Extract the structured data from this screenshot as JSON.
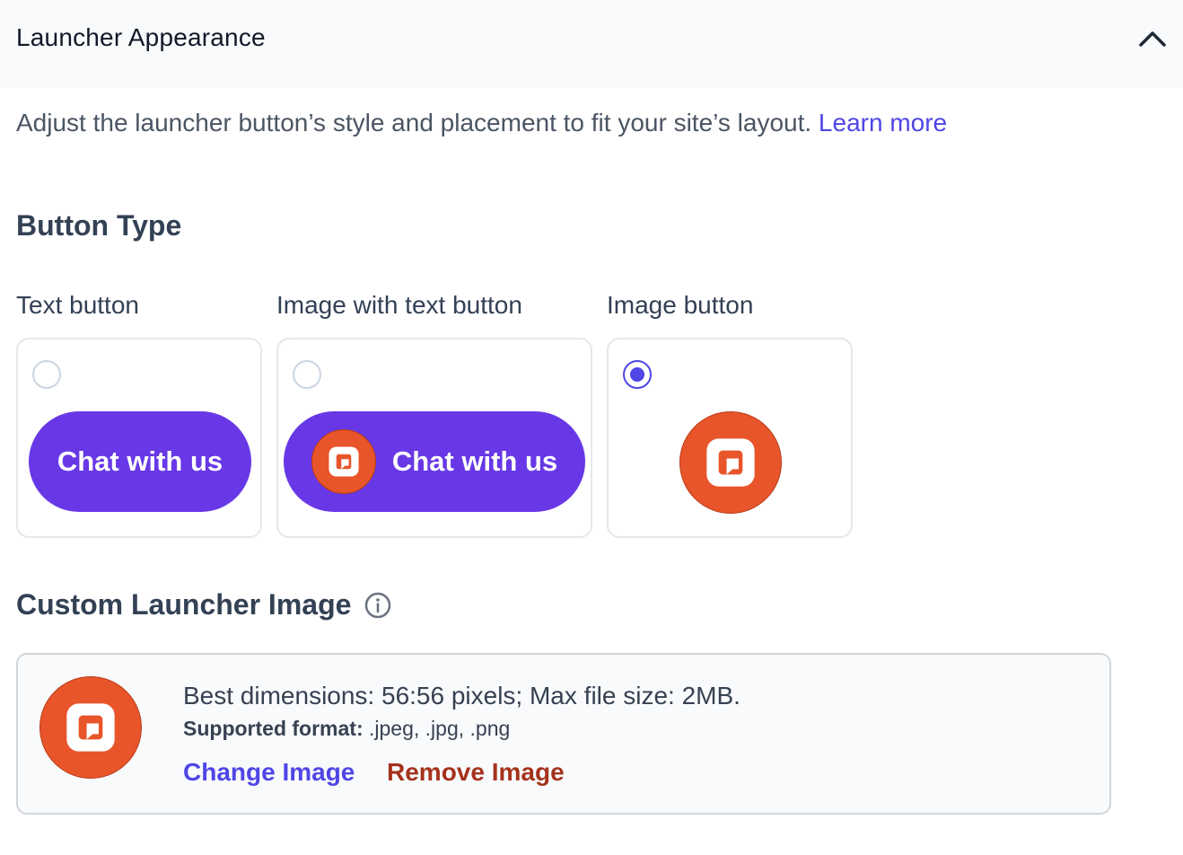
{
  "header": {
    "title": "Launcher Appearance",
    "collapse_icon": "chevron-up-icon"
  },
  "description": {
    "text": "Adjust the launcher button’s style and placement to fit your site’s layout. ",
    "link": "Learn more"
  },
  "button_type": {
    "title": "Button Type",
    "options": [
      {
        "label": "Text button",
        "preview_text": "Chat with us",
        "selected": false
      },
      {
        "label": "Image with text button",
        "preview_text": "Chat with us",
        "selected": false
      },
      {
        "label": "Image button",
        "selected": true
      }
    ]
  },
  "custom_image": {
    "title": "Custom Launcher Image",
    "info_icon": "info-icon",
    "dimensions_text": "Best dimensions: 56:56 pixels; Max file size: 2MB.",
    "format_label": "Supported format:",
    "format_value": " .jpeg, .jpg, .png",
    "change_label": "Change Image",
    "remove_label": "Remove Image"
  },
  "colors": {
    "accent": "#4f46e5",
    "pill": "#6838e6",
    "logo": "#e8552a",
    "remove": "#a5321c"
  }
}
